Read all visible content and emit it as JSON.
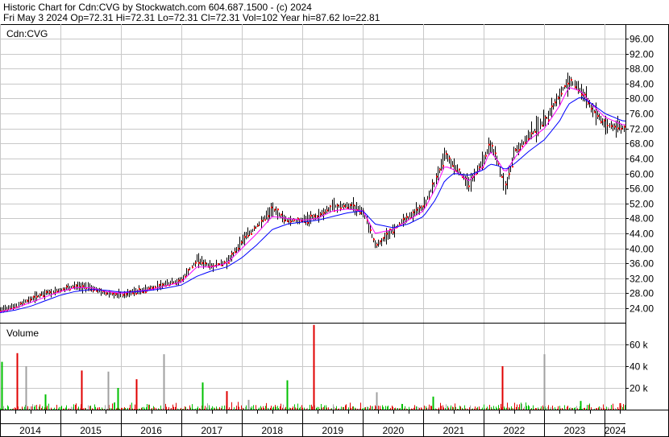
{
  "header": {
    "line1": "Historic Chart for Cdn:CVG by Stockwatch.com 604.687.1500 - (c) 2024",
    "line2": "Fri May  3 2024  Op=72.31  Hi=72.31  Lo=72.31  Cl=72.31  Vol=102  Year hi=87.62  lo=22.81"
  },
  "chart_data": [
    {
      "type": "line",
      "title": "Cdn:CVG",
      "ylim": [
        22,
        100
      ],
      "yticks": [
        "96.00",
        "92.00",
        "88.00",
        "84.00",
        "80.00",
        "76.00",
        "72.00",
        "68.00",
        "64.00",
        "60.00",
        "56.00",
        "52.00",
        "48.00",
        "44.00",
        "40.00",
        "36.00",
        "32.00",
        "28.00",
        "24.00"
      ],
      "x": [
        2014.0,
        2014.25,
        2014.5,
        2014.75,
        2015.0,
        2015.25,
        2015.5,
        2015.75,
        2016.0,
        2016.25,
        2016.5,
        2016.75,
        2017.0,
        2017.25,
        2017.5,
        2017.75,
        2018.0,
        2018.25,
        2018.5,
        2018.75,
        2019.0,
        2019.25,
        2019.5,
        2019.75,
        2020.0,
        2020.2,
        2020.5,
        2020.75,
        2021.0,
        2021.2,
        2021.35,
        2021.5,
        2021.75,
        2022.0,
        2022.1,
        2022.25,
        2022.35,
        2022.5,
        2022.75,
        2023.0,
        2023.25,
        2023.4,
        2023.6,
        2023.75,
        2024.0,
        2024.3
      ],
      "series": [
        {
          "values": [
            23.5,
            24.5,
            26.5,
            28.0,
            29.0,
            30.0,
            29.5,
            28.0,
            27.5,
            28.5,
            29.5,
            30.5,
            31.5,
            37.0,
            35.0,
            36.5,
            42.0,
            46.0,
            50.5,
            47.5,
            47.5,
            48.5,
            51.0,
            51.5,
            50.0,
            40.5,
            45.0,
            48.5,
            51.0,
            58.0,
            65.0,
            62.0,
            57.5,
            64.0,
            68.0,
            62.0,
            56.0,
            66.0,
            70.0,
            74.0,
            81.0,
            85.0,
            82.0,
            78.0,
            73.0,
            72.3
          ]
        },
        {
          "values": [
            23.0,
            24.0,
            25.5,
            27.0,
            28.5,
            29.5,
            29.5,
            28.5,
            28.0,
            28.5,
            29.0,
            30.0,
            31.0,
            35.0,
            35.0,
            36.0,
            40.0,
            44.0,
            48.5,
            48.0,
            47.5,
            48.0,
            50.0,
            50.5,
            50.0,
            44.0,
            45.0,
            47.5,
            50.0,
            56.0,
            62.0,
            61.0,
            58.0,
            62.0,
            66.0,
            63.0,
            60.0,
            64.0,
            69.0,
            72.0,
            78.0,
            83.0,
            82.0,
            79.0,
            75.0,
            73.0
          ]
        },
        {
          "values": [
            22.8,
            23.5,
            24.5,
            26.0,
            27.5,
            28.5,
            29.0,
            28.8,
            28.3,
            28.4,
            28.8,
            29.4,
            30.2,
            32.5,
            34.0,
            35.0,
            37.5,
            41.0,
            45.0,
            46.5,
            47.0,
            47.5,
            48.5,
            49.5,
            50.0,
            46.5,
            45.5,
            46.5,
            48.5,
            53.0,
            58.0,
            60.0,
            59.5,
            61.0,
            62.5,
            62.0,
            61.0,
            62.5,
            66.0,
            69.0,
            74.0,
            78.5,
            80.5,
            79.0,
            76.0,
            74.0
          ]
        }
      ]
    },
    {
      "type": "bar",
      "title": "Volume",
      "ylim": [
        0,
        80000
      ],
      "yticks": [
        "60 k",
        "40 k",
        "20 k"
      ],
      "categories": [
        "2014",
        "2015",
        "2016",
        "2017",
        "2018",
        "2019",
        "2020",
        "2021",
        "2022",
        "2023",
        "2024"
      ],
      "spikes": [
        {
          "x": 2014.02,
          "v": 44000
        },
        {
          "x": 2014.28,
          "v": 52000
        },
        {
          "x": 2014.42,
          "v": 40000
        },
        {
          "x": 2014.75,
          "v": 14000
        },
        {
          "x": 2015.35,
          "v": 36000
        },
        {
          "x": 2015.78,
          "v": 35000
        },
        {
          "x": 2015.95,
          "v": 20000
        },
        {
          "x": 2016.25,
          "v": 28000
        },
        {
          "x": 2016.7,
          "v": 51000
        },
        {
          "x": 2017.35,
          "v": 25000
        },
        {
          "x": 2017.75,
          "v": 17000
        },
        {
          "x": 2018.1,
          "v": 9000
        },
        {
          "x": 2018.75,
          "v": 27000
        },
        {
          "x": 2019.18,
          "v": 78000
        },
        {
          "x": 2020.22,
          "v": 16000
        },
        {
          "x": 2021.15,
          "v": 12000
        },
        {
          "x": 2022.3,
          "v": 40000
        },
        {
          "x": 2023.0,
          "v": 51000
        },
        {
          "x": 2023.6,
          "v": 8000
        },
        {
          "x": 2024.25,
          "v": 6000
        }
      ]
    }
  ],
  "colors": {
    "price": "#000000",
    "ma_short": "#ff00ff",
    "ma_long": "#0000ff",
    "vol_green": "#00c000",
    "vol_red": "#e00000",
    "vol_gray": "#a0a0a0",
    "dot": "#ff0000"
  }
}
